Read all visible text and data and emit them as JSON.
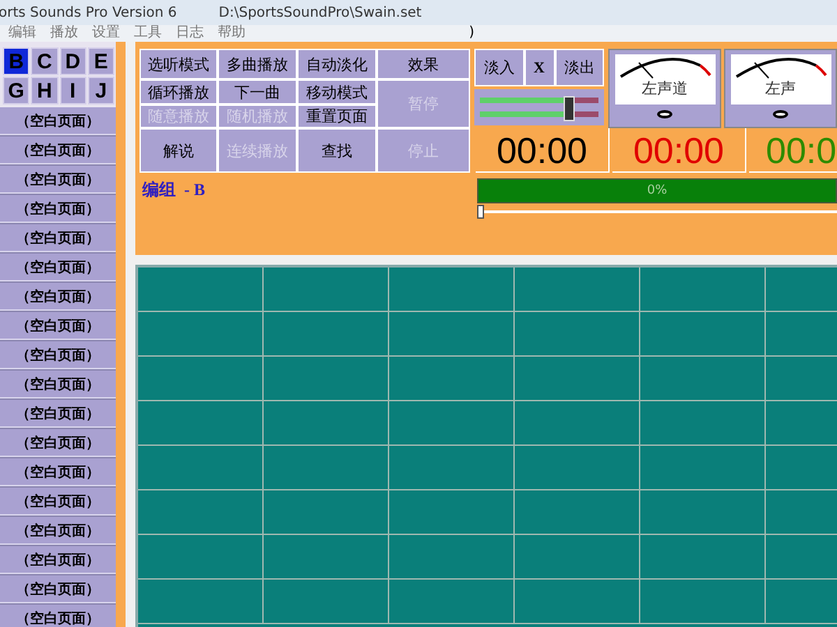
{
  "window": {
    "title": "orts Sounds Pro Version 6",
    "file_path": "D:\\SportsSoundPro\\Swain.set"
  },
  "menu": [
    "编辑",
    "播放",
    "设置",
    "工具",
    "日志",
    "帮助"
  ],
  "menu_extra": ")",
  "bank_rows": [
    [
      {
        "label": "B",
        "selected": true
      },
      {
        "label": "C",
        "selected": false
      },
      {
        "label": "D",
        "selected": false
      },
      {
        "label": "E",
        "selected": false
      }
    ],
    [
      {
        "label": "G",
        "selected": false
      },
      {
        "label": "H",
        "selected": false
      },
      {
        "label": "I",
        "selected": false
      },
      {
        "label": "J",
        "selected": false
      }
    ]
  ],
  "pages": [
    "（空白页面）",
    "（空白页面）",
    "（空白页面）",
    "（空白页面）",
    "（空白页面）",
    "（空白页面）",
    "（空白页面）",
    "（空白页面）",
    "（空白页面）",
    "（空白页面）",
    "（空白页面）",
    "（空白页面）",
    "（空白页面）",
    "（空白页面）",
    "（空白页面）",
    "（空白页面）",
    "（空白页面）",
    "（空白页面）"
  ],
  "controls": [
    {
      "label": "选听模式",
      "kind": "normal",
      "disabled": false
    },
    {
      "label": "多曲播放",
      "kind": "normal",
      "disabled": false
    },
    {
      "label": "自动淡化",
      "kind": "normal",
      "disabled": false
    },
    {
      "label": "效果",
      "kind": "normal",
      "disabled": false
    },
    {
      "label": "循环播放",
      "kind": "normal",
      "disabled": false
    },
    {
      "label": "下一曲",
      "kind": "normal",
      "disabled": false
    },
    {
      "label": "移动模式",
      "kind": "normal",
      "disabled": false
    },
    {
      "label": "暂停",
      "kind": "tall",
      "disabled": true
    },
    {
      "label": "随意播放",
      "kind": "normal",
      "disabled": true
    },
    {
      "label": "随机播放",
      "kind": "normal",
      "disabled": true
    },
    {
      "label": "重置页面",
      "kind": "normal",
      "disabled": false
    },
    {
      "label": "解说",
      "kind": "normal",
      "disabled": false
    },
    {
      "label": "连续播放",
      "kind": "normal",
      "disabled": true
    },
    {
      "label": "查找",
      "kind": "normal",
      "disabled": false
    },
    {
      "label": "停止",
      "kind": "normal",
      "disabled": true
    }
  ],
  "fade": {
    "buttons": [
      "淡入",
      "X",
      "淡出"
    ],
    "level": 0.72
  },
  "meters": [
    {
      "label": "左声道"
    },
    {
      "label": "左声"
    }
  ],
  "timers": [
    {
      "value": "00:00",
      "color": "#000000"
    },
    {
      "value": "00:00",
      "color": "#e00000"
    },
    {
      "value": "00:0",
      "color": "#2e8b00"
    }
  ],
  "group_label": "编组  - B",
  "progress": {
    "text": "0%",
    "level": 1
  },
  "position": {
    "level": 0
  }
}
